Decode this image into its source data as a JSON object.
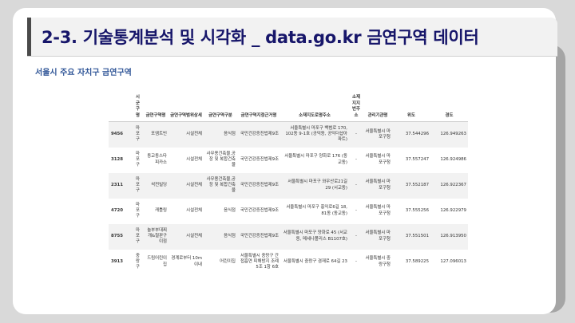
{
  "title": "2-3. 기술통계분석 및 시각화 _ data.go.kr 금연구역 데이터",
  "subtitle": "서울시 주요 자치구 금연구역",
  "table": {
    "headers": [
      "",
      "시군구명",
      "금연구역명",
      "금연구역범위상세",
      "금연구역구분",
      "금연구역지정근거명",
      "소재지도로명주소",
      "소재지지번주소",
      "관리기관명",
      "위도",
      "경도"
    ],
    "rows": [
      [
        "9456",
        "마포구",
        "포엠트빈",
        "시설전체",
        "음식점",
        "국민건강증진법제9조",
        "서울특별시 마포구 백범로 170, 102동 9-1호 (공덕동, 공덕더샵아파트)",
        "-",
        "서울특별시 마포구청",
        "37.544296",
        "126.949263"
      ],
      [
        "3128",
        "마포구",
        "동교동스타피카소",
        "시설전체",
        "사무용건축물,공장 및 복합건축물",
        "국민건강증진법제9조",
        "서울특별시 마포구 양화로 176 (동교동)",
        "-",
        "서울특별시 마포구청",
        "37.557247",
        "126.924986"
      ],
      [
        "2311",
        "마포구",
        "석전빌딩",
        "시설전체",
        "사무용건축물,공장 및 복합건축물",
        "국민건강증진법제9조",
        "서울특별시 마포구 와우산로21길 29 (서교동)",
        "-",
        "서울특별시 마포구청",
        "37.552187",
        "126.922367"
      ],
      [
        "4720",
        "마포구",
        "캐틀링",
        "시설전체",
        "음식점",
        "국민건강증진법제9조",
        "서울특별시 마포구 홍익로6길 18, 81동 (동교동)",
        "-",
        "서울특별시 마포구청",
        "37.555256",
        "126.922979"
      ],
      [
        "8755",
        "마포구",
        "놀부부대찌개&철판구이점",
        "시설전체",
        "음식점",
        "국민건강증진법제9조",
        "서울특별시 마포구 양화로 45 (서교동, 메세나폴리스 B1107호)",
        "-",
        "서울특별시 마포구청",
        "37.551501",
        "126.913950"
      ],
      [
        "3913",
        "중랑구",
        "드림어린이집",
        "경계로부터 10m 이내",
        "어린이집",
        "서울특별시 중랑구 간접흡연 피해방지 조례 5조 1항 6호",
        "서울특별시 중랑구 겸재로 64길 23",
        "-",
        "서울특별시 중랑구청",
        "37.589225",
        "127.096013"
      ]
    ]
  },
  "icons": {
    "scroll": "down-arrow-icon"
  }
}
